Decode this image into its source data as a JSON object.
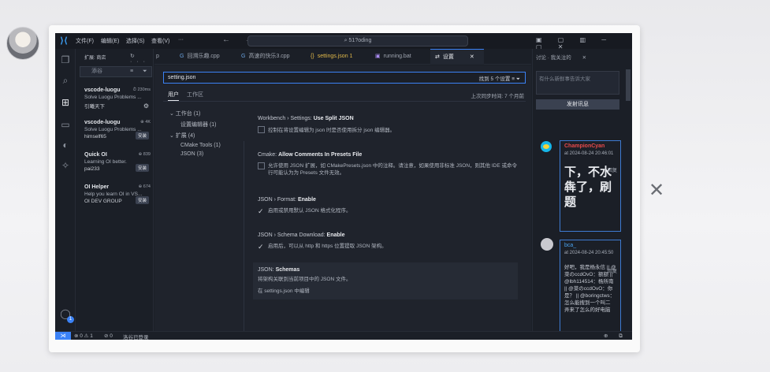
{
  "window": {
    "menu": [
      "文件(F)",
      "编辑(E)",
      "选择(S)",
      "查看(V)",
      "···"
    ],
    "nav_arrows": "← →",
    "command_center": "51?oding",
    "controls": "▣ ▢ ▥ ─ ▢ ✕"
  },
  "sidebar": {
    "title": "扩展: 商店",
    "header_icons": "↻ ···",
    "search_placeholder": "添谷",
    "search_icons": "≡ ⏷",
    "extensions": [
      {
        "name": "vscode-luogu",
        "downloads": "⏱ 230ms",
        "desc": "Solve Luogu Problems ...",
        "publisher": "引曦天下",
        "action": "⚙"
      },
      {
        "name": "vscode-luogu",
        "downloads": "⊕ 4K",
        "desc": "Solve Luogu Problems ...",
        "publisher": "himself65",
        "action": "安装"
      },
      {
        "name": "Quick OI",
        "downloads": "⊕ 839",
        "desc": "Learning OI better.",
        "publisher": "pai233",
        "action": "安装"
      },
      {
        "name": "OI Helper",
        "downloads": "⊕ 674",
        "desc": "Help you learn OI in VS...",
        "publisher": "OI DEV GROUP",
        "action": "安装"
      }
    ]
  },
  "tabs": [
    {
      "icon": "p",
      "label": "p"
    },
    {
      "icon": "G",
      "label": "回溯乐趣.cpp"
    },
    {
      "icon": "G",
      "label": "高速的快乐3.cpp"
    },
    {
      "icon": "{}",
      "label": "settings.json 1"
    },
    {
      "icon": "▣",
      "label": "running.bat"
    },
    {
      "icon": "⇄",
      "label": "设置",
      "close": "✕"
    }
  ],
  "tab_icons": "▷ ▯ ▥ ···",
  "settings": {
    "search_value": "setting.json",
    "result_count": "找到 5 个设置",
    "search_icons": "≡ ⏷",
    "scope_tabs": [
      "用户",
      "工作区"
    ],
    "sync_text": "上次同步时间: 7 个月前",
    "toc": [
      "⌄ 工作台 (1)",
      "设置编辑器 (1)",
      "⌄ 扩展 (4)",
      "CMake Tools (1)",
      "JSON (3)"
    ],
    "items": [
      {
        "category": "Workbench › Settings: ",
        "name": "Use Split JSON",
        "desc": "控制在将设置编辑为 json 时是否使用拆分 json 编辑器。",
        "checked": false
      },
      {
        "category": "Cmake: ",
        "name": "Allow Comments In Presets File",
        "desc": "允许使用 JSON 扩展，如 CMakePresets.json 中的注释。请注意，如果使用非标准 JSON，则其他 IDE 或命令行可能认为为 Presets 文件无效。",
        "checked": false
      },
      {
        "category": "JSON › Format: ",
        "name": "Enable",
        "desc": "启用或禁用默认 JSON 格式化程序。",
        "checked": true
      },
      {
        "category": "JSON › Schema Download: ",
        "name": "Enable",
        "desc": "启用后，可以从 http 和 https 位置提取 JSON 架构。",
        "checked": true
      },
      {
        "category": "JSON: ",
        "name": "Schemas",
        "desc": "将架构关联到当前项目中的 JSON 文件。",
        "link": "在 settings.json 中编辑"
      }
    ]
  },
  "right_panel": {
    "tab": "讨论 · 我关注的",
    "close": "✕",
    "input_placeholder": "有什么新鲜事告诉大家",
    "post_button": "发射讯息",
    "comments": [
      {
        "user": "ChampionCyan",
        "time": "at 2024-08-24 20:46:01",
        "reply": "回复",
        "text": "下，不水犇了，刷题"
      },
      {
        "user": "bca_",
        "time": "at 2024-08-24 20:45:50",
        "reply": "回复",
        "text": "好吧，我是杨永信 || @菜のccdOvO：额额 || @lbh114514：杨所南 || @菜のccdOvO：你是？ || @boringctws：怎么能搜到一个叫二 弄来了怎么的好电脑"
      }
    ]
  },
  "statusbar": {
    "remote": "⋊",
    "problems": "⊗ 0 ⚠ 1",
    "ports": "⊘ 0",
    "login": "洛谷已登录",
    "right_icons": "⊕ ⧉"
  },
  "close_overlay": "✕"
}
